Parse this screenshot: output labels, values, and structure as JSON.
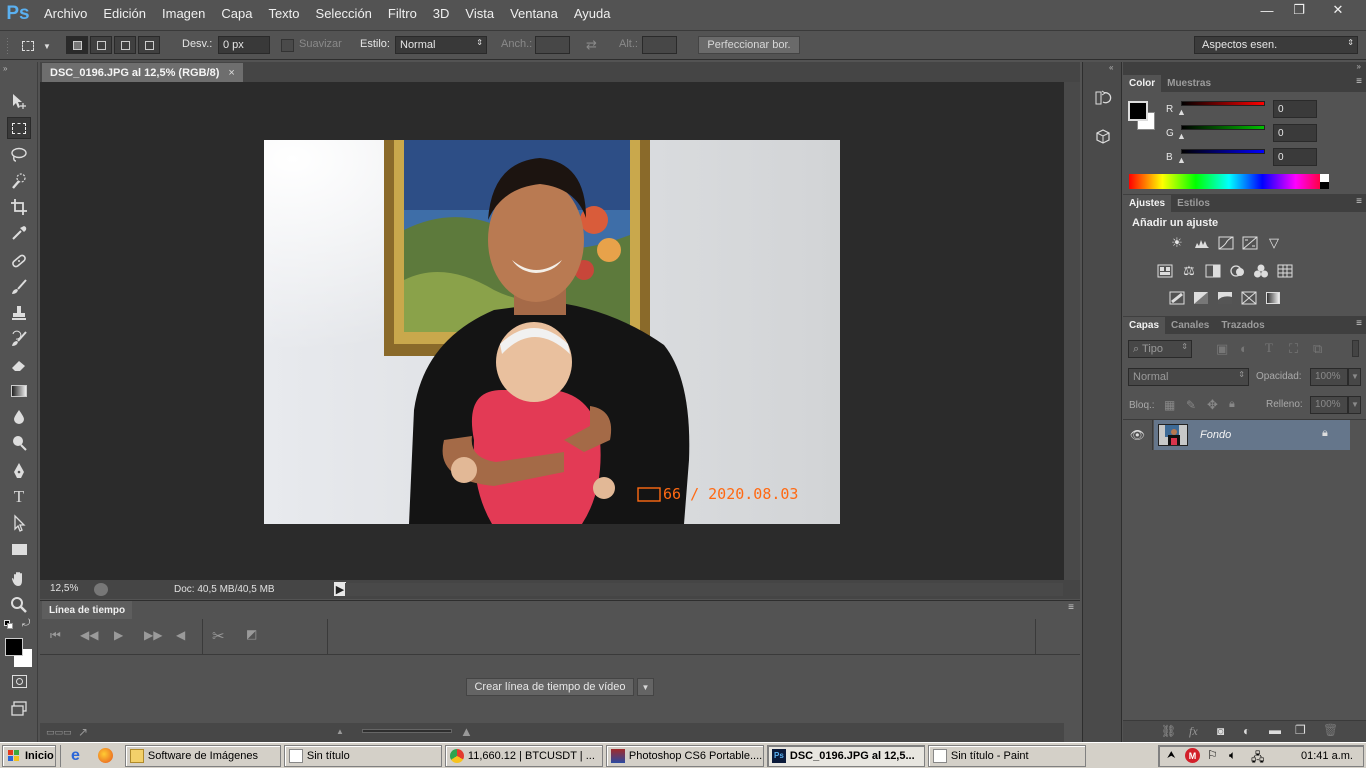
{
  "app": {
    "logo": "Ps"
  },
  "menu": [
    "Archivo",
    "Edición",
    "Imagen",
    "Capa",
    "Texto",
    "Selección",
    "Filtro",
    "3D",
    "Vista",
    "Ventana",
    "Ayuda"
  ],
  "window_controls": {
    "minimize": "—",
    "restore": "❐",
    "close": "✕"
  },
  "options": {
    "feather_label": "Desv.:",
    "feather_value": "0 px",
    "smooth_label": "Suavizar",
    "style_label": "Estilo:",
    "style_value": "Normal",
    "width_label": "Anch.:",
    "height_label": "Alt.:",
    "refine_label": "Perfeccionar bor.",
    "workspace": "Aspectos esen."
  },
  "document": {
    "tab_title": "DSC_0196.JPG al 12,5% (RGB/8)",
    "zoom": "12,5%",
    "doc_size": "Doc: 40,5 MB/40,5 MB",
    "photo_stamp": "66 / 2020.08.03"
  },
  "timeline": {
    "tab": "Línea de tiempo",
    "create_button": "Crear línea de tiempo de vídeo"
  },
  "color_panel": {
    "tabs": [
      "Color",
      "Muestras"
    ],
    "channels": [
      {
        "label": "R",
        "value": "0",
        "color": "#ff0000"
      },
      {
        "label": "G",
        "value": "0",
        "color": "#00c000"
      },
      {
        "label": "B",
        "value": "0",
        "color": "#0000ff"
      }
    ]
  },
  "adjust_panel": {
    "tabs": [
      "Ajustes",
      "Estilos"
    ],
    "heading": "Añadir un ajuste"
  },
  "layers_panel": {
    "tabs": [
      "Capas",
      "Canales",
      "Trazados"
    ],
    "filter": "Tipo",
    "blend_mode": "Normal",
    "opacity_label": "Opacidad:",
    "opacity_value": "100%",
    "lock_label": "Bloq.:",
    "fill_label": "Relleno:",
    "fill_value": "100%",
    "layers": [
      {
        "name": "Fondo",
        "visible": true,
        "locked": true
      }
    ]
  },
  "taskbar": {
    "start": "Inicio",
    "tasks": [
      {
        "label": "Software de Imágenes",
        "active": false
      },
      {
        "label": "Sin título",
        "active": false
      },
      {
        "label": "11,660.12 | BTCUSDT | ...",
        "active": false
      },
      {
        "label": "Photoshop CS6 Portable....",
        "active": false
      },
      {
        "label": "DSC_0196.JPG al 12,5...",
        "active": true
      },
      {
        "label": "Sin título - Paint",
        "active": false
      }
    ],
    "clock": "01:41 a.m."
  },
  "colors": {
    "accent": "#5ab0f0",
    "panel_bg": "#535353",
    "canvas_bg": "#2b2b2b",
    "stamp": "#ff6a13"
  }
}
